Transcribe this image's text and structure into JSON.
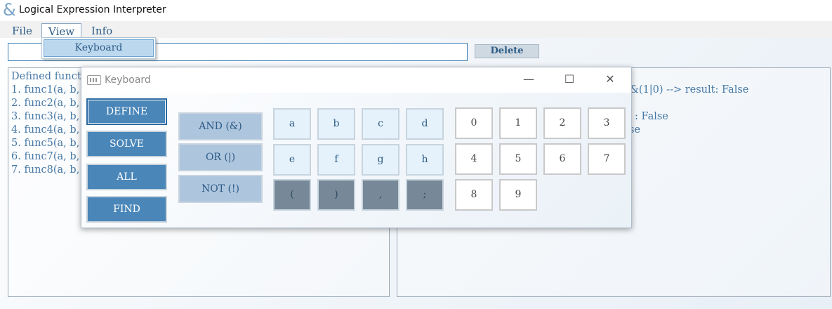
{
  "window": {
    "icon": "ampersand-icon",
    "icon_glyph": "&",
    "title": "Logical Expression Interpreter"
  },
  "menu": {
    "items": [
      {
        "label": "File"
      },
      {
        "label": "View"
      },
      {
        "label": "Info"
      }
    ],
    "open_menu": "View",
    "dropdown": {
      "items": [
        {
          "label": "Keyboard"
        }
      ]
    }
  },
  "expression_input": {
    "value": "",
    "placeholder": ""
  },
  "delete_label": "Delete",
  "left_panel": {
    "title": "Defined funct",
    "lines": [
      "1. func1(a, b,",
      "2. func2(a, b,",
      "3. func3(a, b,",
      "4. func4(a, b,",
      "5. func5(a, b,",
      "6. func7(a, b,",
      "7. func8(a, b,"
    ]
  },
  "right_panel": {
    "lines": [
      "",
      "&(1|0) --> result: False",
      "",
      ": False",
      "se"
    ]
  },
  "keyboard_window": {
    "title": "Keyboard",
    "icon": "keyboard-icon",
    "minimize_glyph": "—",
    "maximize_glyph": "☐",
    "close_glyph": "✕",
    "commands": [
      {
        "label": "DEFINE",
        "selected": true
      },
      {
        "label": "SOLVE"
      },
      {
        "label": "ALL"
      },
      {
        "label": "FIND"
      }
    ],
    "operators": [
      {
        "label": "AND (&)"
      },
      {
        "label": "OR (|)"
      },
      {
        "label": "NOT (!)"
      }
    ],
    "letters": [
      "a",
      "b",
      "c",
      "d",
      "e",
      "f",
      "g",
      "h"
    ],
    "punctuation": [
      "(",
      ")",
      ",",
      ";"
    ],
    "digits": [
      "0",
      "1",
      "2",
      "3",
      "4",
      "5",
      "6",
      "7",
      "8",
      "9"
    ]
  },
  "colors": {
    "accent": "#4a86b8",
    "text": "#2c5b85",
    "operator_bg": "#aec5de",
    "letter_bg": "#e6f2fb",
    "punct_bg": "#778898"
  }
}
